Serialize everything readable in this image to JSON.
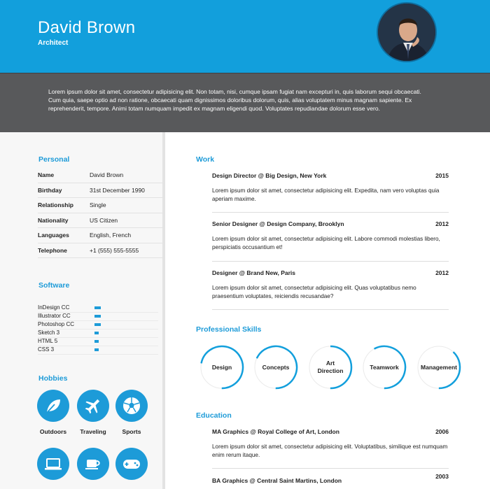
{
  "header": {
    "name": "David Brown",
    "role": "Architect"
  },
  "intro": "Lorem ipsum dolor sit amet, consectetur adipisicing elit. Non totam, nisi, cumque ipsam fugiat nam excepturi in, quis laborum sequi obcaecati. Cum quia, saepe optio ad non ratione, obcaecati quam dignissimos doloribus dolorum, quis, alias voluptatem minus magnam sapiente. Ex reprehenderit, tempore. Animi totam numquam impedit ex magnam eligendi quod. Voluptates repudiandae dolorum esse vero.",
  "personal": {
    "title": "Personal",
    "rows": [
      {
        "key": "Name",
        "value": "David Brown"
      },
      {
        "key": "Birthday",
        "value": "31st December 1990"
      },
      {
        "key": "Relationship",
        "value": "Single"
      },
      {
        "key": "Nationality",
        "value": "US Citizen"
      },
      {
        "key": "Languages",
        "value": "English, French"
      },
      {
        "key": "Telephone",
        "value": "+1 (555) 555-5555"
      }
    ]
  },
  "software": {
    "title": "Software",
    "items": [
      {
        "label": "InDesign CC",
        "level": 0.1
      },
      {
        "label": "Illustrator CC",
        "level": 0.1
      },
      {
        "label": "Photoshop CC",
        "level": 0.1
      },
      {
        "label": "Sketch 3",
        "level": 0.05
      },
      {
        "label": "HTML 5",
        "level": 0.05
      },
      {
        "label": "CSS 3",
        "level": 0.05
      }
    ]
  },
  "hobbies": {
    "title": "Hobbies",
    "items": [
      {
        "label": "Outdoors",
        "icon": "leaf-icon"
      },
      {
        "label": "Traveling",
        "icon": "airplane-icon"
      },
      {
        "label": "Sports",
        "icon": "soccer-ball-icon"
      },
      {
        "label": "",
        "icon": "laptop-icon"
      },
      {
        "label": "",
        "icon": "coffee-cup-icon"
      },
      {
        "label": "",
        "icon": "gamepad-icon"
      }
    ]
  },
  "work": {
    "title": "Work",
    "jobs": [
      {
        "title": "Design Director @ Big Design, New York",
        "year": "2015",
        "desc": "Lorem ipsum dolor sit amet, consectetur adipisicing elit. Expedita, nam vero voluptas quia aperiam maxime."
      },
      {
        "title": "Senior Designer @ Design Company, Brooklyn",
        "year": "2012",
        "desc": "Lorem ipsum dolor sit amet, consectetur adipisicing elit. Labore commodi molestias libero, perspiciatis occusantium et!"
      },
      {
        "title": "Designer @ Brand New, Paris",
        "year": "2012",
        "desc": "Lorem ipsum dolor sit amet, consectetur adipisicing elit. Quas voluptatibus nemo praesentium voluptates, reiciendis recusandae?"
      }
    ]
  },
  "skills": {
    "title": "Professional Skills",
    "items": [
      {
        "label": "Design",
        "level": 0.72
      },
      {
        "label": "Concepts",
        "level": 0.68
      },
      {
        "label": "Art Direction",
        "level": 0.5
      },
      {
        "label": "Teamwork",
        "level": 0.58
      },
      {
        "label": "Management",
        "level": 0.38
      }
    ]
  },
  "education": {
    "title": "Education",
    "entries": [
      {
        "title": "MA Graphics @ Royal College of Art, London",
        "year": "2006",
        "desc": "Lorem ipsum dolor sit amet, consectetur adipisicing elit. Voluptatibus, similique est numquam enim rerum itaque."
      },
      {
        "title": "BA Graphics @ Central Saint Martins, London",
        "year": "2003",
        "desc": ""
      }
    ]
  },
  "colors": {
    "accent": "#129fdc",
    "intro_bg": "#58595b"
  }
}
